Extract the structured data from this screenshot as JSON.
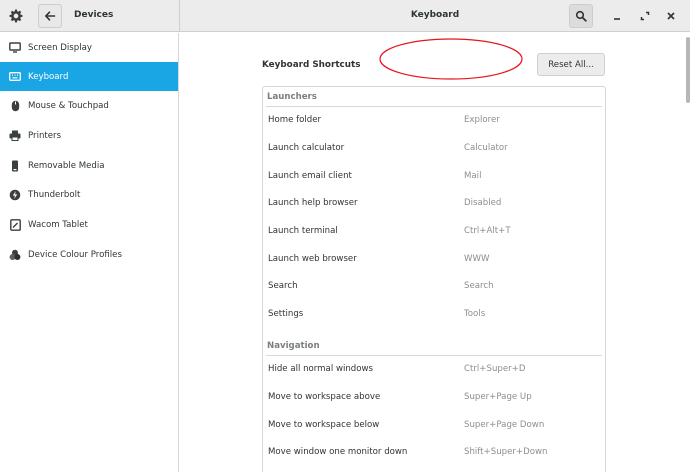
{
  "header": {
    "left_title": "Devices",
    "center_title": "Keyboard"
  },
  "sidebar": {
    "items": [
      {
        "label": "Screen Display",
        "icon": "display-icon"
      },
      {
        "label": "Keyboard",
        "icon": "keyboard-icon",
        "active": true
      },
      {
        "label": "Mouse & Touchpad",
        "icon": "mouse-icon"
      },
      {
        "label": "Printers",
        "icon": "printer-icon"
      },
      {
        "label": "Removable Media",
        "icon": "removable-media-icon"
      },
      {
        "label": "Thunderbolt",
        "icon": "thunderbolt-icon"
      },
      {
        "label": "Wacom Tablet",
        "icon": "tablet-icon"
      },
      {
        "label": "Device Colour Profiles",
        "icon": "color-profiles-icon"
      }
    ]
  },
  "main": {
    "section_title": "Keyboard Shortcuts",
    "reset_label": "Reset All...",
    "groups": [
      {
        "title": "Launchers",
        "rows": [
          {
            "name": "Home folder",
            "accel": "Explorer"
          },
          {
            "name": "Launch calculator",
            "accel": "Calculator"
          },
          {
            "name": "Launch email client",
            "accel": "Mail"
          },
          {
            "name": "Launch help browser",
            "accel": "Disabled"
          },
          {
            "name": "Launch terminal",
            "accel": "Ctrl+Alt+T"
          },
          {
            "name": "Launch web browser",
            "accel": "WWW"
          },
          {
            "name": "Search",
            "accel": "Search"
          },
          {
            "name": "Settings",
            "accel": "Tools"
          }
        ]
      },
      {
        "title": "Navigation",
        "rows": [
          {
            "name": "Hide all normal windows",
            "accel": "Ctrl+Super+D"
          },
          {
            "name": "Move to workspace above",
            "accel": "Super+Page Up"
          },
          {
            "name": "Move to workspace below",
            "accel": "Super+Page Down"
          },
          {
            "name": "Move window one monitor down",
            "accel": "Shift+Super+Down"
          }
        ]
      }
    ]
  },
  "colors": {
    "accent": "#1aa6e4",
    "annotation": "#e8141c"
  }
}
